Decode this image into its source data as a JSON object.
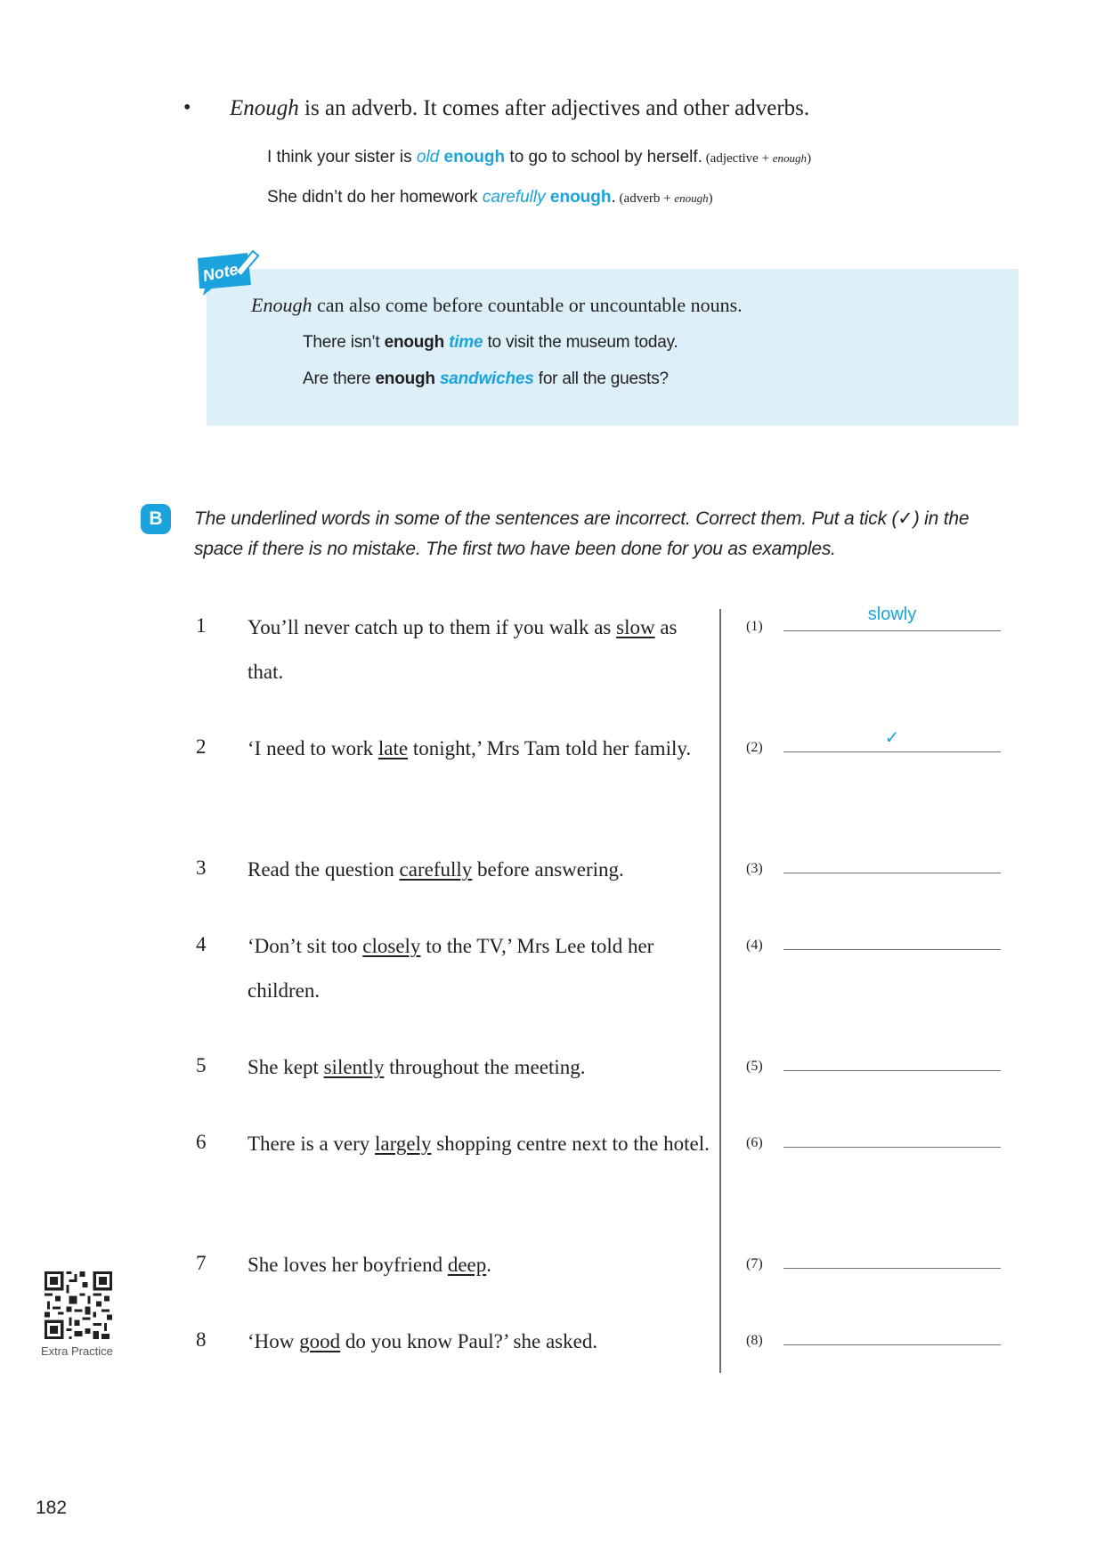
{
  "rule": {
    "bullet": "•",
    "enough_word": "Enough",
    "text": " is an adverb. It comes after adjectives and other adverbs."
  },
  "examples": [
    {
      "before": "I think your sister is ",
      "highlight": "old",
      "keyword": " enough",
      "after": " to go to school by herself.",
      "tag_open": " (adjective + ",
      "tag_word": "enough",
      "tag_close": ")"
    },
    {
      "before": "She didn’t do her homework ",
      "highlight": "carefully",
      "keyword": " enough",
      "after": ".",
      "tag_open": " (adverb + ",
      "tag_word": "enough",
      "tag_close": ")"
    }
  ],
  "note": {
    "tag_label": "Note",
    "main_word": "Enough",
    "main_text": " can also come before countable or uncountable nouns.",
    "examples": [
      {
        "before": "There isn’t ",
        "keyword": "enough",
        "highlight": "time",
        "after": " to visit the museum today."
      },
      {
        "before": "Are there ",
        "keyword": "enough",
        "highlight": "sandwiches",
        "after": " for all the guests?"
      }
    ]
  },
  "exercise": {
    "badge": "B",
    "instruction": "The underlined words in some of the sentences are incorrect. Correct them. Put a tick (✓) in the space if there is no mistake. The first two have been done for you as examples.",
    "items": [
      {
        "num": "1",
        "before": "You’ll never catch up to them if you walk as ",
        "underlined": "slow",
        "after": " as that.",
        "label": "(1)",
        "answer": "slowly"
      },
      {
        "num": "2",
        "before": "‘I need to work ",
        "underlined": "late",
        "after": " tonight,’ Mrs Tam told her family.",
        "label": "(2)",
        "answer": "✓"
      },
      {
        "num": "3",
        "before": "Read the question ",
        "underlined": "carefully",
        "after": " before answering.",
        "label": "(3)",
        "answer": ""
      },
      {
        "num": "4",
        "before": "‘Don’t sit too ",
        "underlined": "closely",
        "after": " to the TV,’ Mrs Lee told her children.",
        "label": "(4)",
        "answer": ""
      },
      {
        "num": "5",
        "before": "She kept ",
        "underlined": "silently",
        "after": " throughout the meeting.",
        "label": "(5)",
        "answer": ""
      },
      {
        "num": "6",
        "before": "There is a very ",
        "underlined": "largely",
        "after": " shopping centre next to the hotel.",
        "label": "(6)",
        "answer": ""
      },
      {
        "num": "7",
        "before": "She loves her boyfriend ",
        "underlined": "deep",
        "after": ".",
        "label": "(7)",
        "answer": ""
      },
      {
        "num": "8",
        "before": "‘How ",
        "underlined": "good",
        "after": " do you know Paul?’ she asked.",
        "label": "(8)",
        "answer": ""
      }
    ]
  },
  "footer": {
    "qr_label": "Extra Practice",
    "page_number": "182"
  },
  "colors": {
    "accent": "#1aa3dc",
    "note_bg": "#ddeff9",
    "text": "#231f20"
  }
}
